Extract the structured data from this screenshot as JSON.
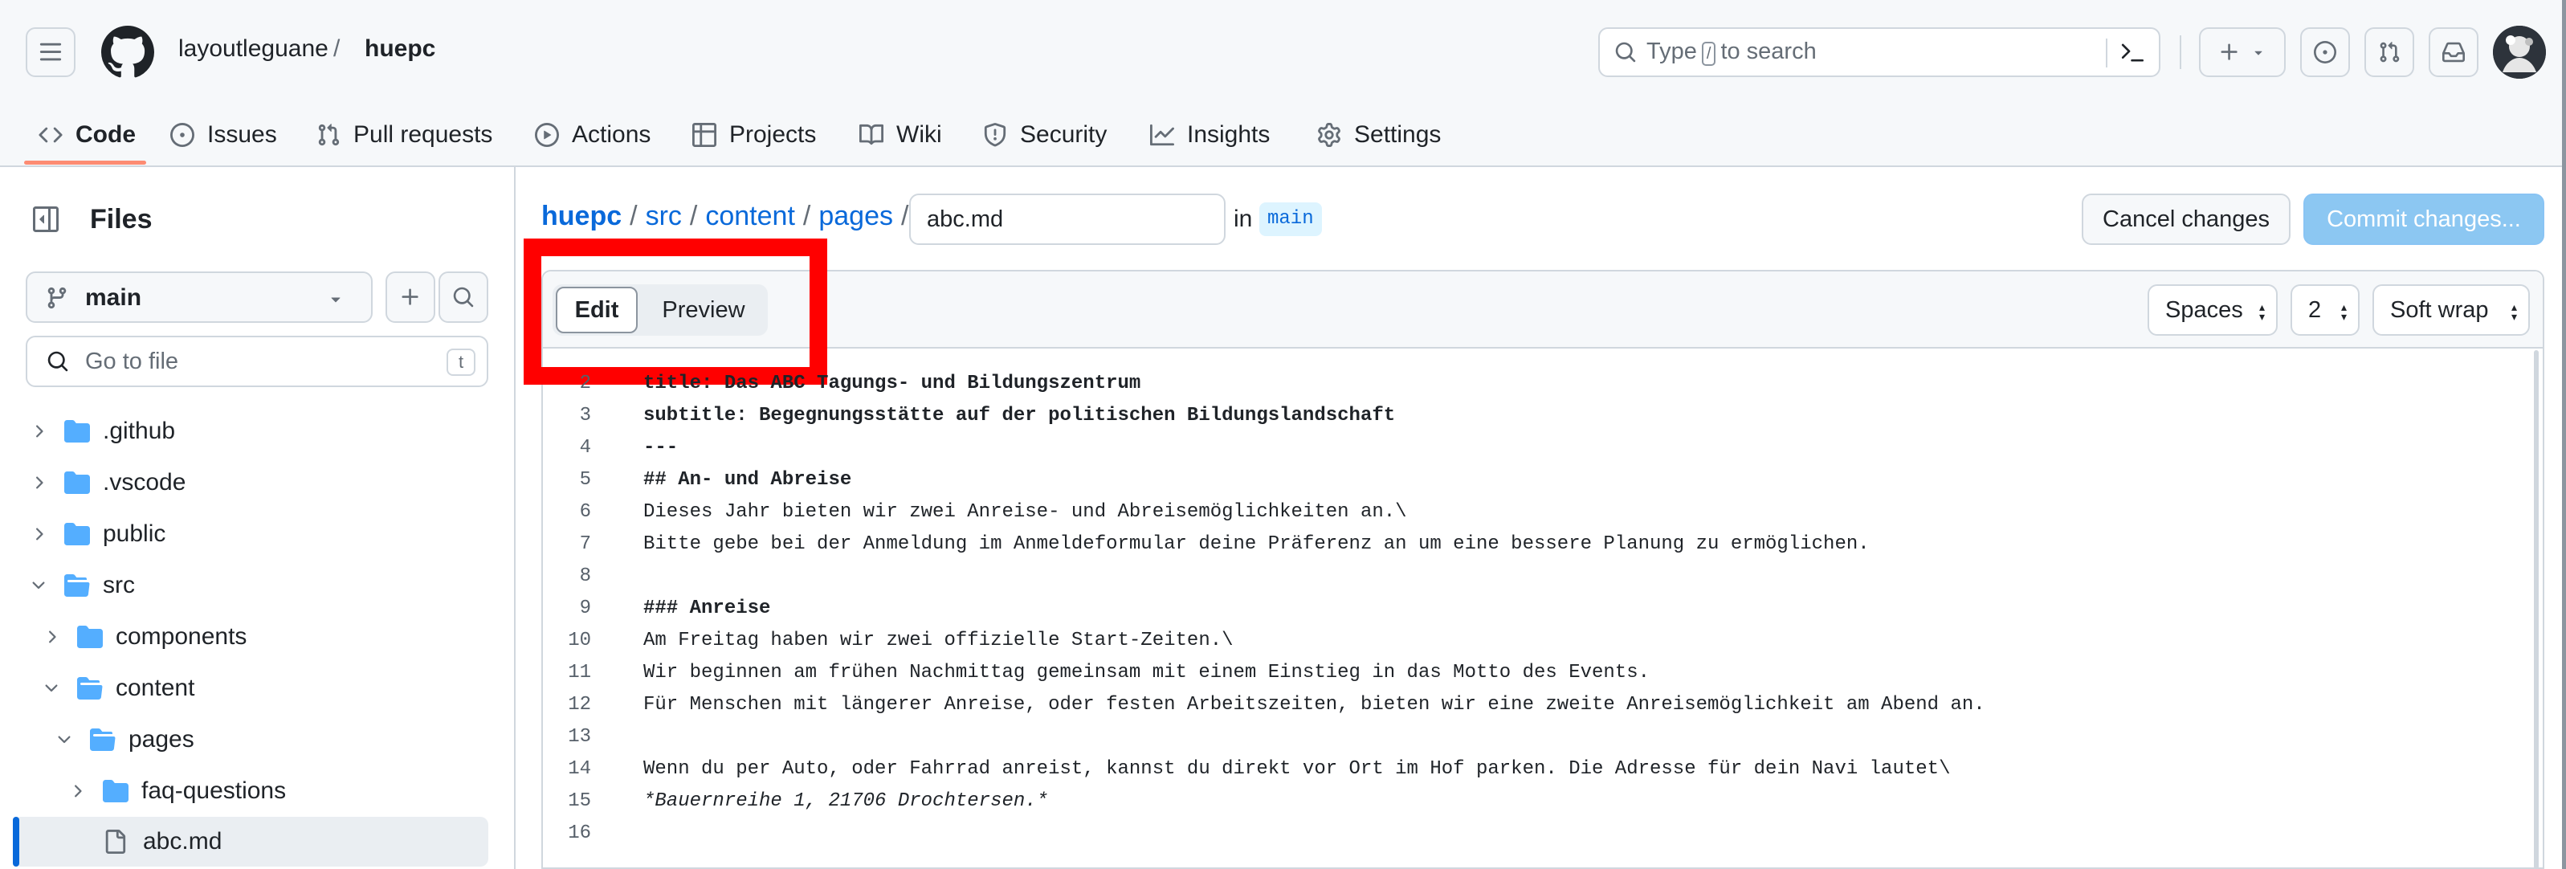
{
  "header": {
    "owner": "layoutleguane",
    "separator": "/",
    "repo": "huepc",
    "search_placeholder_pre": "Type",
    "search_kbd": "/",
    "search_placeholder_post": "to search"
  },
  "tabs": [
    {
      "label": "Code",
      "icon": "code-icon"
    },
    {
      "label": "Issues",
      "icon": "issue-icon"
    },
    {
      "label": "Pull requests",
      "icon": "pull-request-icon"
    },
    {
      "label": "Actions",
      "icon": "play-icon"
    },
    {
      "label": "Projects",
      "icon": "table-icon"
    },
    {
      "label": "Wiki",
      "icon": "book-icon"
    },
    {
      "label": "Security",
      "icon": "shield-icon"
    },
    {
      "label": "Insights",
      "icon": "graph-icon"
    },
    {
      "label": "Settings",
      "icon": "gear-icon"
    }
  ],
  "sidebar": {
    "title": "Files",
    "branch": "main",
    "goto_placeholder": "Go to file",
    "goto_kbd": "t",
    "tree": [
      {
        "name": ".github",
        "type": "folder",
        "expanded": false
      },
      {
        "name": ".vscode",
        "type": "folder",
        "expanded": false
      },
      {
        "name": "public",
        "type": "folder",
        "expanded": false
      },
      {
        "name": "src",
        "type": "folder",
        "expanded": true
      },
      {
        "name": "components",
        "type": "folder",
        "expanded": false
      },
      {
        "name": "content",
        "type": "folder",
        "expanded": true
      },
      {
        "name": "pages",
        "type": "folder",
        "expanded": true
      },
      {
        "name": "faq-questions",
        "type": "folder",
        "expanded": false
      },
      {
        "name": "abc.md",
        "type": "file",
        "selected": true
      }
    ]
  },
  "editor": {
    "path": [
      "huepc",
      "src",
      "content",
      "pages"
    ],
    "path_sep": "/",
    "filename": "abc.md",
    "in_label": "in",
    "branch": "main",
    "cancel_label": "Cancel changes",
    "commit_label": "Commit changes...",
    "mode_edit": "Edit",
    "mode_preview": "Preview",
    "indent_mode": "Spaces",
    "indent_size": "2",
    "wrap_mode": "Soft wrap",
    "lines": [
      {
        "n": "2",
        "text": "title: Das ABC Tagungs- und Bildungszentrum",
        "style": "b"
      },
      {
        "n": "3",
        "text": "subtitle: Begegnungsstätte auf der politischen Bildungslandschaft",
        "style": "b"
      },
      {
        "n": "4",
        "text": "---",
        "style": "b"
      },
      {
        "n": "5",
        "text": "## An- und Abreise",
        "style": "b"
      },
      {
        "n": "6",
        "text": "Dieses Jahr bieten wir zwei Anreise- und Abreisemöglichkeiten an.\\",
        "style": ""
      },
      {
        "n": "7",
        "text": "Bitte gebe bei der Anmeldung im Anmeldeformular deine Präferenz an um eine bessere Planung zu ermöglichen.",
        "style": ""
      },
      {
        "n": "8",
        "text": "",
        "style": ""
      },
      {
        "n": "9",
        "text": "### Anreise",
        "style": "b"
      },
      {
        "n": "10",
        "text": "Am Freitag haben wir zwei offizielle Start-Zeiten.\\",
        "style": ""
      },
      {
        "n": "11",
        "text": "Wir beginnen am frühen Nachmittag gemeinsam mit einem Einstieg in das Motto des Events.",
        "style": ""
      },
      {
        "n": "12",
        "text": "Für Menschen mit längerer Anreise, oder festen Arbeitszeiten, bieten wir eine zweite Anreisemöglichkeit am Abend an.",
        "style": ""
      },
      {
        "n": "13",
        "text": "",
        "style": ""
      },
      {
        "n": "14",
        "text": "Wenn du per Auto, oder Fahrrad anreist, kannst du direkt vor Ort im Hof parken. Die Adresse für dein Navi lautet\\",
        "style": ""
      },
      {
        "n": "15",
        "text": "*Bauernreihe 1, 21706 Drochtersen.*",
        "style": "i"
      },
      {
        "n": "16",
        "text": "",
        "style": ""
      }
    ]
  },
  "colors": {
    "link": "#0969da",
    "highlight": "#ff0000",
    "tab_underline": "#fd8c73",
    "commit_disabled": "#8cc7f2",
    "folder": "#54aeff"
  }
}
